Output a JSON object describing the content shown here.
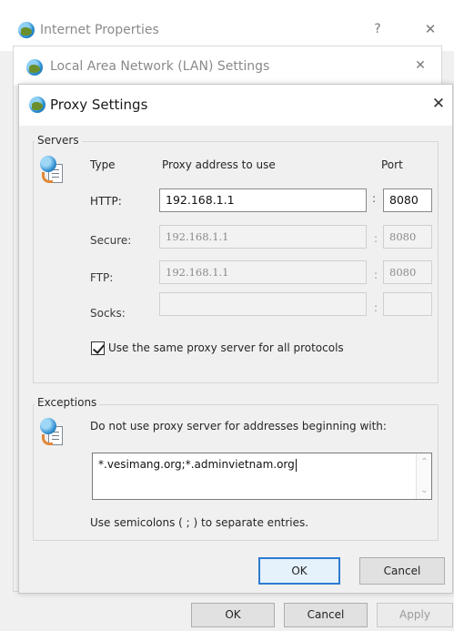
{
  "inet_window": {
    "title": "Internet Properties",
    "help_glyph": "?",
    "close_glyph": "✕",
    "buttons": {
      "ok": "OK",
      "cancel": "Cancel",
      "apply": "Apply"
    }
  },
  "lan_window": {
    "title": "Local Area Network (LAN) Settings",
    "close_glyph": "✕"
  },
  "proxy_dialog": {
    "title": "Proxy Settings",
    "close_glyph": "✕",
    "servers": {
      "group_title": "Servers",
      "headers": {
        "type": "Type",
        "address": "Proxy address to use",
        "port": "Port"
      },
      "rows": [
        {
          "label": "HTTP:",
          "address": "192.168.1.1",
          "port": "8080",
          "enabled": true
        },
        {
          "label": "Secure:",
          "address": "192.168.1.1",
          "port": "8080",
          "enabled": false
        },
        {
          "label": "FTP:",
          "address": "192.168.1.1",
          "port": "8080",
          "enabled": false
        },
        {
          "label": "Socks:",
          "address": "",
          "port": "",
          "enabled": false
        }
      ],
      "same_proxy_label": "Use the same proxy server for all protocols",
      "same_proxy_checked": true
    },
    "exceptions": {
      "group_title": "Exceptions",
      "description": "Do not use proxy server for addresses beginning with:",
      "value": "*.vesimang.org;*.adminvietnam.org",
      "hint": "Use semicolons ( ; ) to separate entries."
    },
    "buttons": {
      "ok": "OK",
      "cancel": "Cancel"
    }
  }
}
